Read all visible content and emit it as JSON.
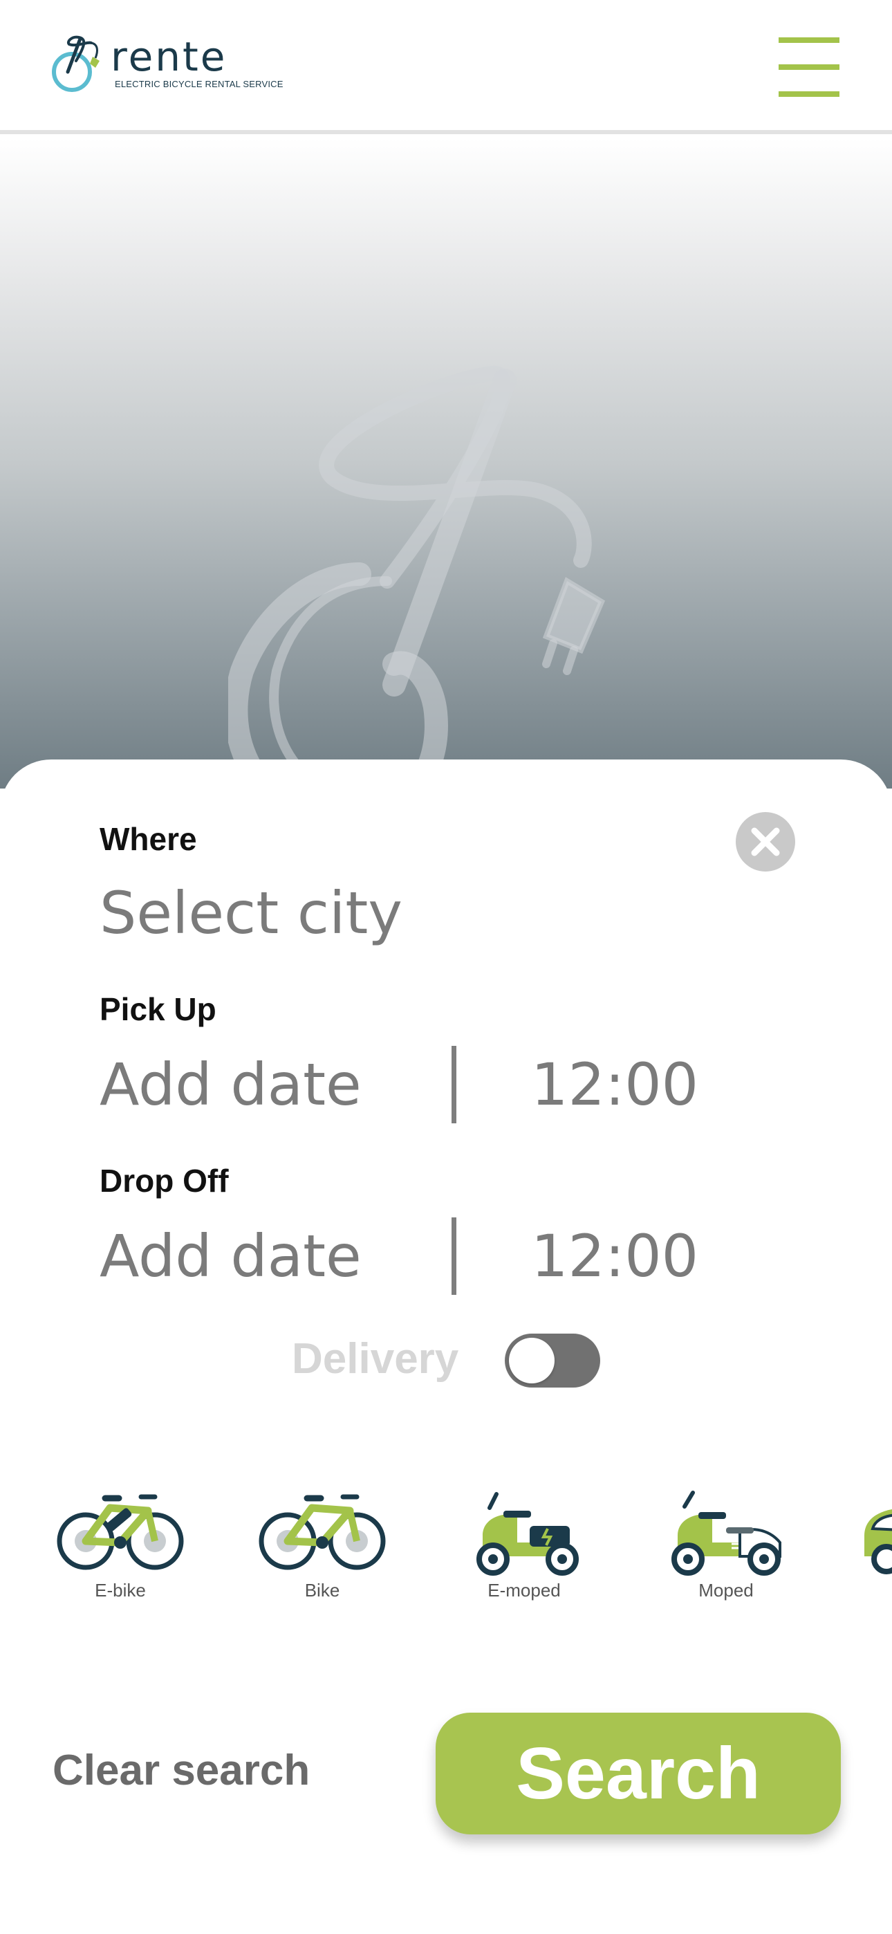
{
  "brand": {
    "name": "rente",
    "tagline": "ELECTRIC BICYCLE RENTAL SERVICE",
    "accent_color": "#a3c34a",
    "dark_color": "#1b3a4a"
  },
  "header": {
    "menu_icon": "hamburger-menu-icon"
  },
  "search_form": {
    "where": {
      "label": "Where",
      "placeholder": "Select city",
      "clear_icon": "close-icon"
    },
    "pick_up": {
      "label": "Pick Up",
      "date_placeholder": "Add date",
      "time": "12:00"
    },
    "drop_off": {
      "label": "Drop Off",
      "date_placeholder": "Add date",
      "time": "12:00"
    },
    "delivery": {
      "label": "Delivery",
      "enabled": false
    }
  },
  "vehicle_types": [
    {
      "label": "E-bike",
      "icon": "e-bike-icon"
    },
    {
      "label": "Bike",
      "icon": "bike-icon"
    },
    {
      "label": "E-moped",
      "icon": "e-moped-icon"
    },
    {
      "label": "Moped",
      "icon": "moped-icon"
    },
    {
      "label": "",
      "icon": "car-icon"
    }
  ],
  "actions": {
    "clear_label": "Clear search",
    "search_label": "Search",
    "search_color": "#a8c450"
  }
}
